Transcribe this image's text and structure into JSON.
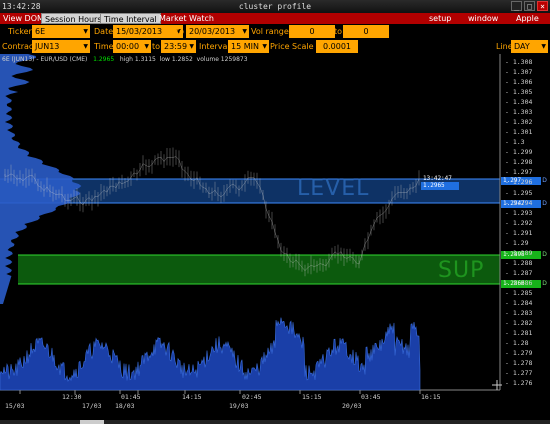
{
  "titlebar": {
    "time": "13:42:28",
    "title": "cluster profile"
  },
  "menubar": {
    "items": [
      "View DOM",
      "Session Hours",
      "Time Interval",
      "Market Watch"
    ],
    "right": [
      "setup",
      "window",
      "Apple"
    ]
  },
  "row1": {
    "ticker_label": "Ticker",
    "ticker_value": "6E",
    "date_label": "Date",
    "date_from": "15/03/2013",
    "to_label": "to",
    "date_to": "20/03/2013",
    "volrange_label": "Vol range",
    "volrange_from": "0",
    "volrange_to_label": "to",
    "volrange_to": "0"
  },
  "row2": {
    "contract_label": "Contract",
    "contract_value": "JUN13",
    "time_label": "Time",
    "time_from": "00:00",
    "to_label": "to",
    "time_to": "23:59",
    "interval_label": "Interval",
    "interval_value": "15 MIN",
    "pricescale_label": "Price Scale",
    "pricescale_value": "0.0001",
    "line_label": "Line",
    "line_value": "DAY"
  },
  "chart": {
    "symbol": "6E (JUN13) - EUR/USD (CME)",
    "last": "1.2965",
    "high": "high 1.3115",
    "low": "low 1.2852",
    "volume": "volume 1259873",
    "level_label": "LEVEL",
    "sup_label": "SUP",
    "timestamp": "13:42:47",
    "current_price": "1.2965",
    "tag_d": "D",
    "colors": {
      "level": "#1f6fe0",
      "sup": "#17b31a",
      "profile": "#2a5cc8",
      "price": "#e0e0e0"
    },
    "price_labels": [
      "1.308",
      "1.307",
      "1.306",
      "1.305",
      "1.304",
      "1.303",
      "1.302",
      "1.301",
      "1.3",
      "1.299",
      "1.298",
      "1.297",
      "1.296",
      "1.295",
      "1.294",
      "1.293",
      "1.292",
      "1.291",
      "1.29",
      "1.289",
      "1.288",
      "1.287",
      "1.286",
      "1.285",
      "1.284",
      "1.283",
      "1.282",
      "1.281",
      "1.28",
      "1.279",
      "1.278",
      "1.277",
      "1.276"
    ],
    "level_tag_top": "1.297",
    "level_tag_bottom": "1.2947",
    "sup_tag_top": "1.2895",
    "sup_tag_bottom": "1.2866",
    "x_labels_top": [
      "12:30",
      "01:45",
      "14:15",
      "02:45",
      "15:15",
      "03:45",
      "16:15"
    ],
    "x_labels_bottom": [
      "15/03",
      "17/03",
      "18/03",
      "19/03",
      "20/03"
    ]
  }
}
